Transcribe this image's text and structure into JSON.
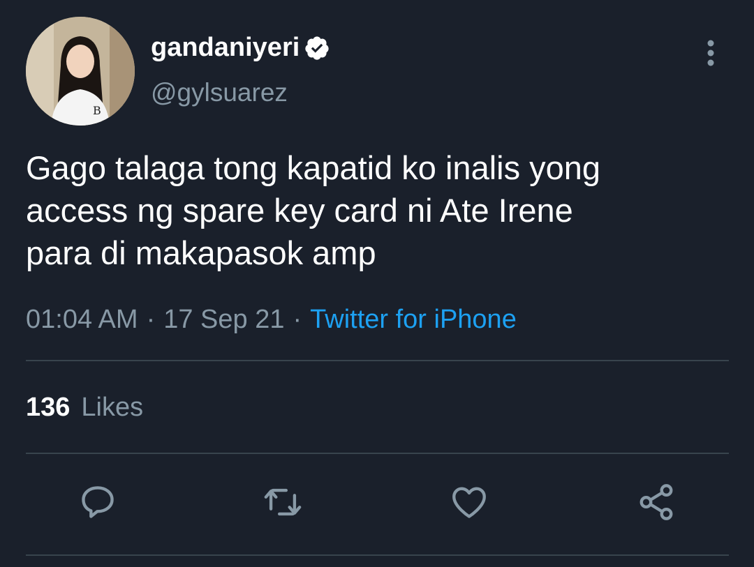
{
  "tweet": {
    "author": {
      "display_name": "gandaniyeri",
      "handle": "@gylsuarez",
      "verified": true
    },
    "text": "Gago talaga tong kapatid ko inalis yong\naccess ng spare key card ni Ate Irene\npara di makapasok amp",
    "time": "01:04 AM",
    "date": "17 Sep 21",
    "separator": "·",
    "source": "Twitter for iPhone",
    "likes": {
      "count": "136",
      "label": "Likes"
    }
  },
  "actions": [
    {
      "name": "reply",
      "icon": "reply-icon"
    },
    {
      "name": "retweet",
      "icon": "retweet-icon"
    },
    {
      "name": "like",
      "icon": "heart-icon"
    },
    {
      "name": "share",
      "icon": "share-icon"
    }
  ],
  "colors": {
    "background": "#1a202b",
    "text": "#ffffff",
    "secondary": "#8899a6",
    "link": "#1da1f2",
    "divider": "#38444d"
  }
}
